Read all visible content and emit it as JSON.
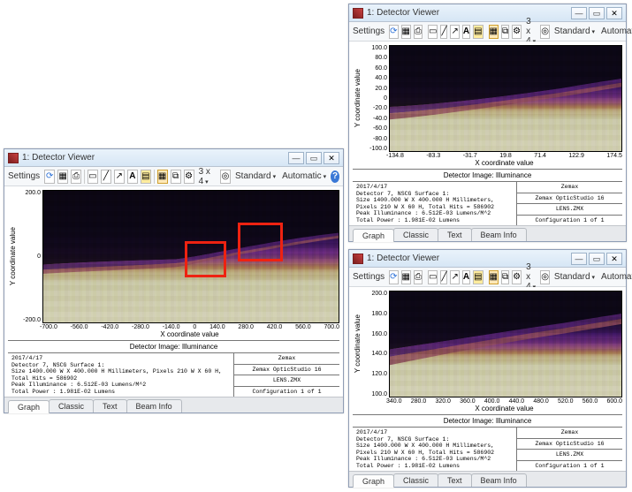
{
  "product": {
    "vendor_line": "Zemax",
    "product_line": "Zemax OpticStudio 16",
    "lens_file": "LENS.ZMX",
    "config_line": "Configuration 1 of 1"
  },
  "toolbar": {
    "settings_label": "Settings",
    "grid_label": "3 x 4",
    "std_label": "Standard",
    "auto_label": "Automatic"
  },
  "tabs": {
    "graph": "Graph",
    "classic": "Classic",
    "text": "Text",
    "beam": "Beam Info"
  },
  "axis": {
    "xlabel": "X coordinate value",
    "ylabel": "Y coordinate value"
  },
  "status": {
    "heading": "Detector Image: Illuminance",
    "date": "2017/4/17",
    "det_line": "Detector 7, NSCG Surface 1:",
    "size_line": "Size 1400.000 W X 400.000 H Millimeters, Pixels 210 W X 60 H, Total Hits = 586902",
    "peak_line": "Peak Illuminance : 6.512E-03 Lumens/M^2",
    "power_line": "Total Power     : 1.981E-02 Lumens"
  },
  "winA": {
    "title": "1: Detector Viewer",
    "yticks": [
      "200.0",
      "0",
      "-200.0"
    ],
    "xticks": [
      "-700.0",
      "-560.0",
      "-420.0",
      "-280.0",
      "-140.0",
      "0",
      "140.0",
      "280.0",
      "420.0",
      "560.0",
      "700.0"
    ]
  },
  "winB": {
    "title": "1: Detector Viewer",
    "yticks": [
      "100.0",
      "80.0",
      "60.0",
      "40.0",
      "20.0",
      "0",
      "-20.0",
      "-40.0",
      "-60.0",
      "-80.0",
      "-100.0"
    ],
    "xticks": [
      "-134.8",
      "-83.3",
      "-31.7",
      "19.8",
      "71.4",
      "122.9",
      "174.5"
    ]
  },
  "winC": {
    "title": "1: Detector Viewer",
    "yticks": [
      "200.0",
      "180.0",
      "160.0",
      "140.0",
      "120.0",
      "100.0"
    ],
    "xticks": [
      "340.0",
      "280.0",
      "320.0",
      "360.0",
      "400.0",
      "440.0",
      "480.0",
      "520.0",
      "560.0",
      "600.0"
    ]
  }
}
